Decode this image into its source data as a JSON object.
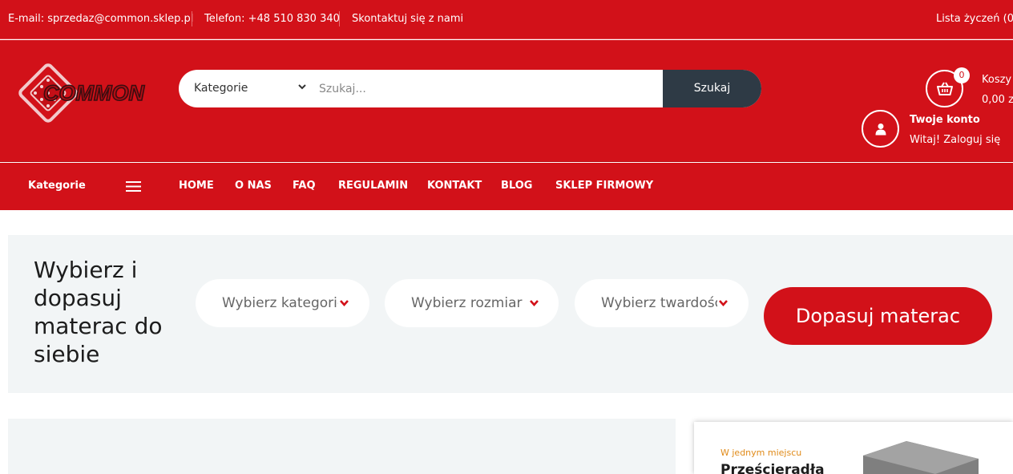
{
  "topbar": {
    "email": "E-mail: sprzedaz@common.sklep.pl",
    "phone": "Telefon: +48 510 830 340",
    "contact": "Skontaktuj się z nami",
    "wishlist": "Lista życzeń (0"
  },
  "header": {
    "logo_text": "COMMON",
    "search": {
      "category_label": "Kategorie",
      "placeholder": "Szukaj...",
      "button_label": "Szukaj"
    },
    "cart": {
      "count": "0",
      "label": "Koszy",
      "total": "0,00 z"
    },
    "account": {
      "title": "Twoje konto",
      "subtitle": "Witaj! Zaloguj się"
    }
  },
  "nav": {
    "categories_label": "Kategorie",
    "links": [
      "HOME",
      "O NAS",
      "FAQ",
      "REGULAMIN",
      "KONTAKT",
      "BLOG",
      "SKLEP FIRMOWY"
    ]
  },
  "finder": {
    "title": "Wybierz i dopasuj materac do siebie",
    "selects": [
      "Wybierz kategorię",
      "Wybierz rozmiar",
      "Wybierz twardość"
    ],
    "button_label": "Dopasuj materac"
  },
  "banner": {
    "small_text": "W jednym miejscu",
    "big_text": "Prześcieradła"
  },
  "colors": {
    "brand_red": "#d21119",
    "dark_button": "#2e3a45",
    "light_panel": "#f2f5f6",
    "accent_orange": "#e08a18"
  }
}
